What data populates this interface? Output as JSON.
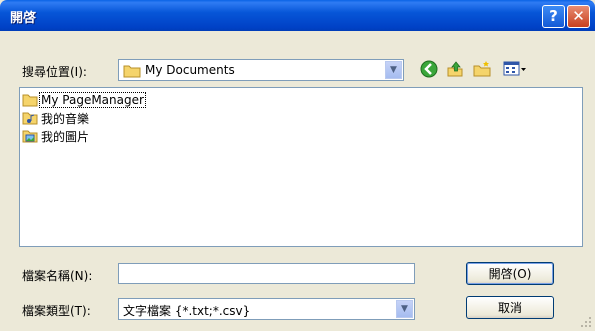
{
  "window": {
    "title": "開啓",
    "help_glyph": "?",
    "close_glyph": "✕"
  },
  "look_in": {
    "label": "搜尋位置(I):",
    "value": "My Documents"
  },
  "toolbar": {
    "icons": [
      "back-icon",
      "up-folder-icon",
      "new-folder-icon",
      "views-menu-icon"
    ]
  },
  "files": [
    {
      "name": "My PageManager",
      "icon": "folder-icon",
      "selected": true
    },
    {
      "name": "我的音樂",
      "icon": "music-folder-icon",
      "selected": false
    },
    {
      "name": "我的圖片",
      "icon": "pictures-folder-icon",
      "selected": false
    }
  ],
  "filename": {
    "label": "檔案名稱(N):",
    "value": ""
  },
  "filetype": {
    "label": "檔案類型(T):",
    "value": "文字檔案 {*.txt;*.csv}"
  },
  "buttons": {
    "open": "開啓(O)",
    "cancel": "取消"
  }
}
